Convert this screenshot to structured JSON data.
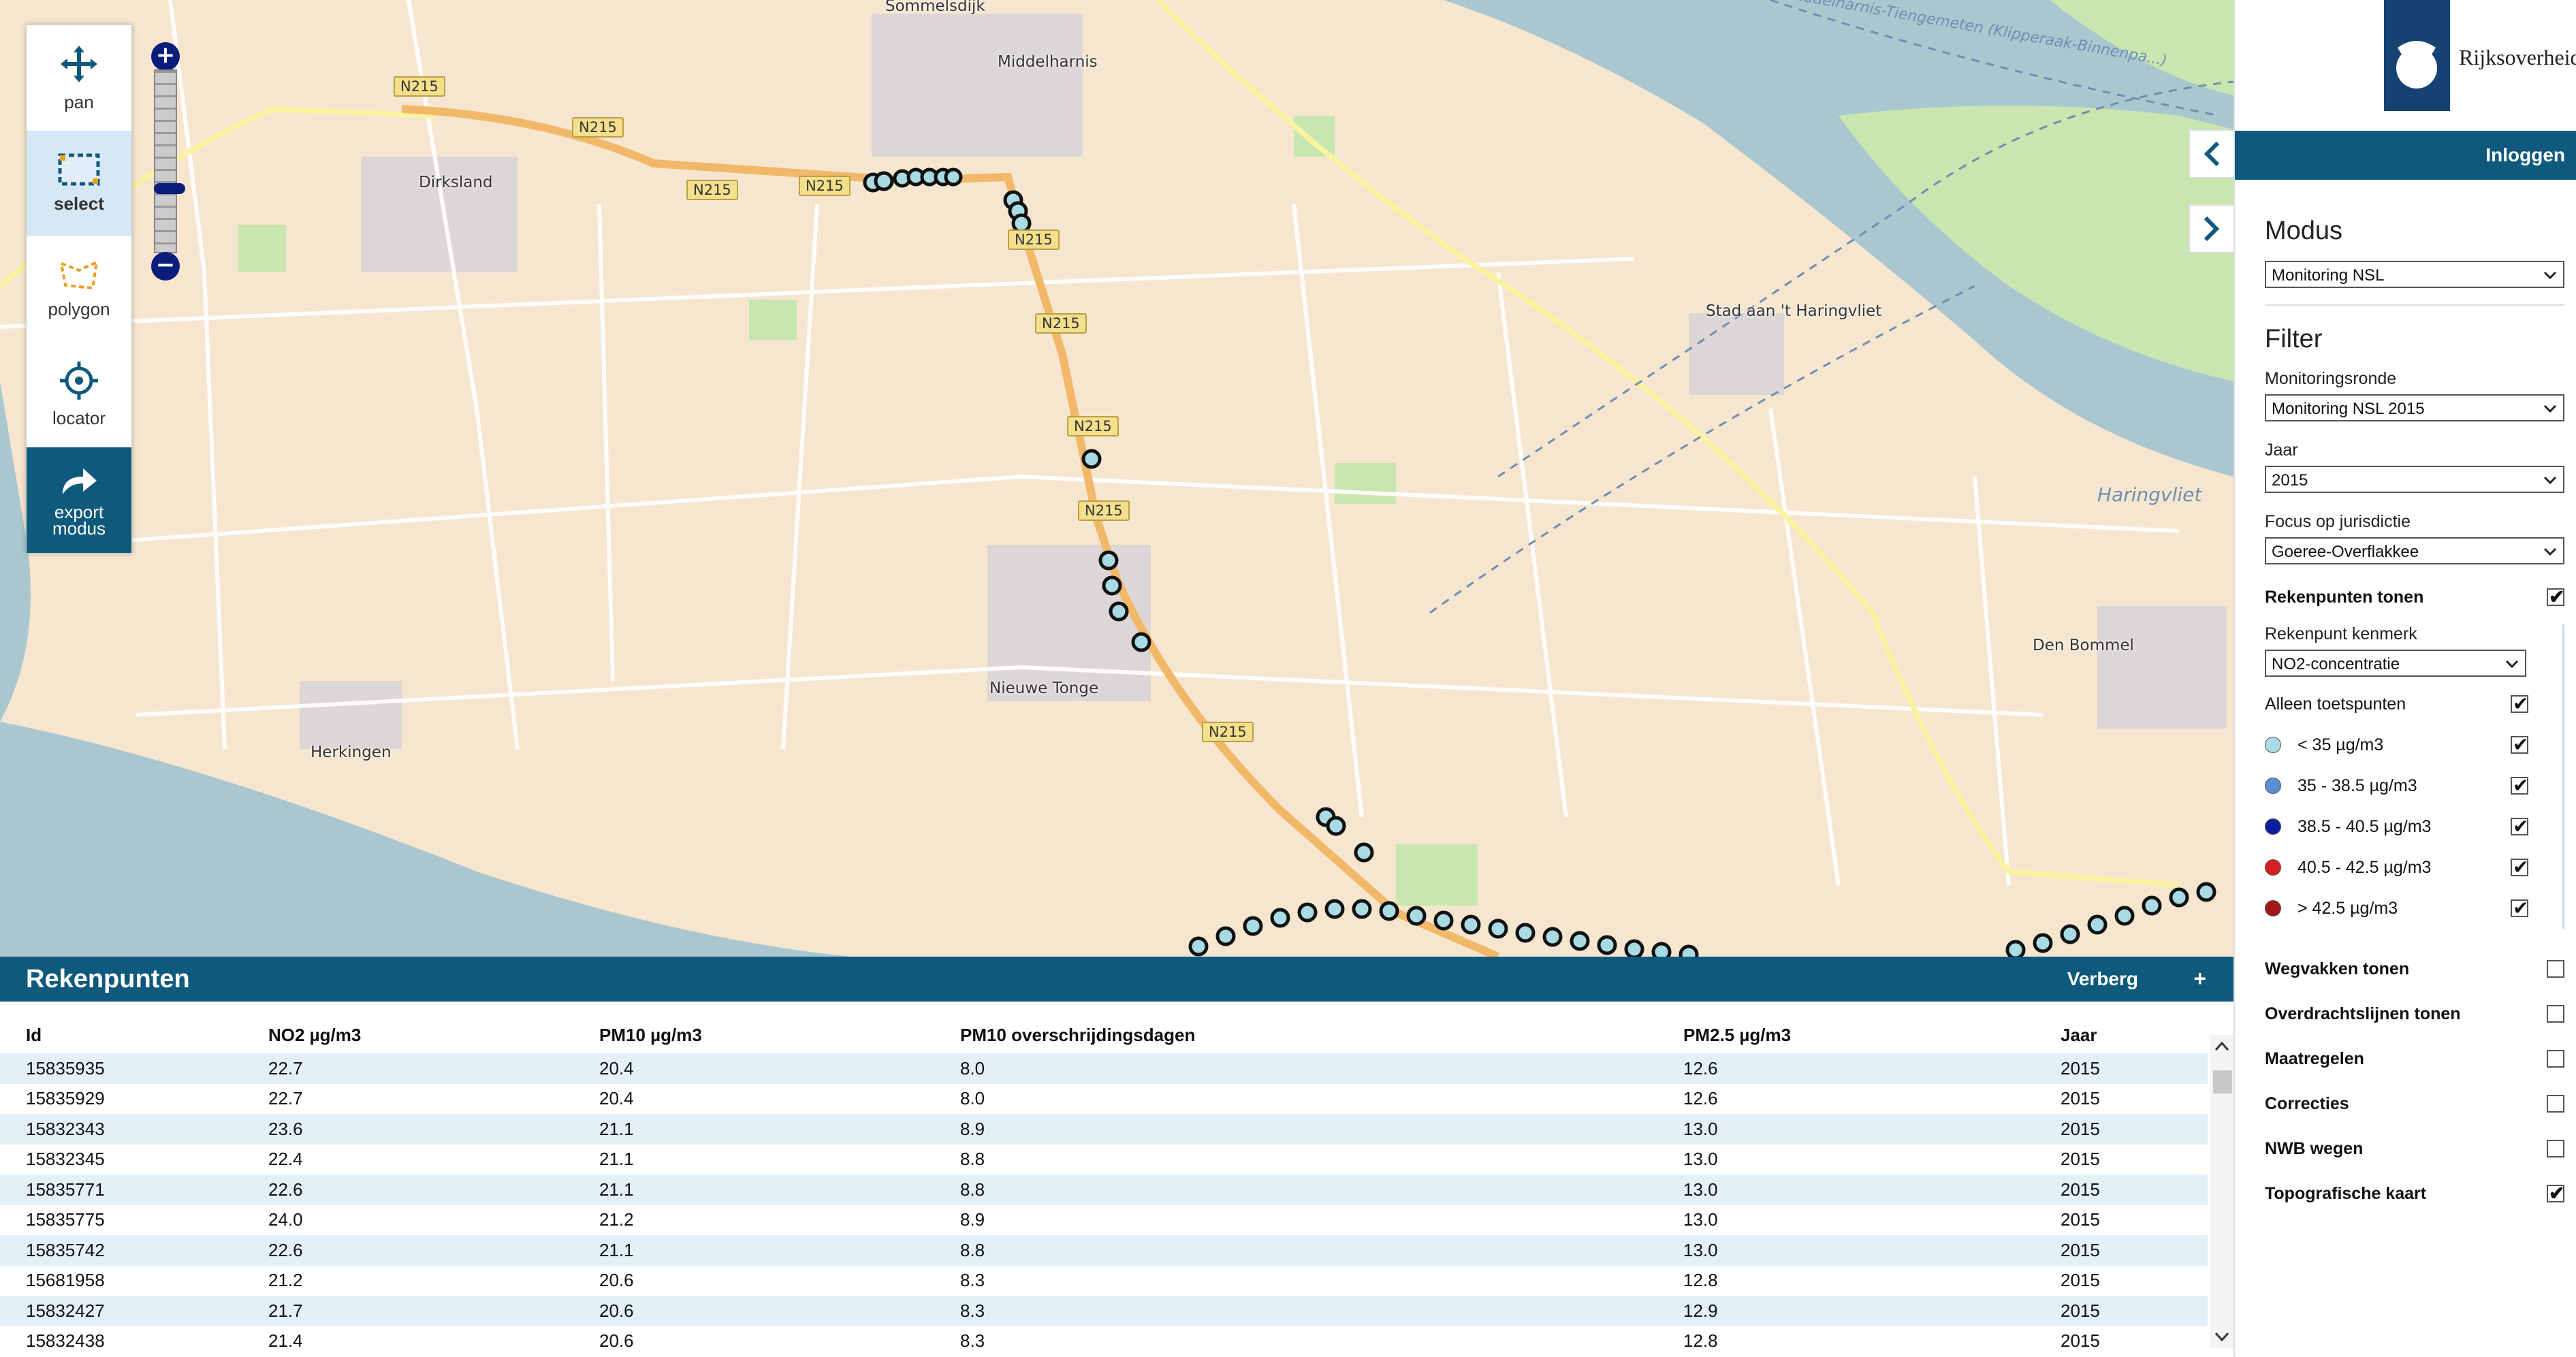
{
  "toolbar": {
    "tools": [
      {
        "label": "pan",
        "icon": "pan-icon"
      },
      {
        "label": "select",
        "icon": "select-icon"
      },
      {
        "label": "polygon",
        "icon": "polygon-icon"
      },
      {
        "label": "locator",
        "icon": "locator-icon"
      },
      {
        "label": "export modus",
        "icon": "export-icon"
      }
    ]
  },
  "zoom": {
    "plus": "+",
    "minus": "−"
  },
  "map": {
    "places": [
      "Middelharnis",
      "Dirksland",
      "Stad aan 't Haringvliet",
      "Nieuwe Tonge",
      "Herkingen",
      "Den Bommel",
      "Sommelsdijk"
    ],
    "water_labels": [
      "Haringvliet",
      "Middelharnis-Tiengemeten (Klipperaak-Binnenpa...)"
    ],
    "roads": [
      "N215",
      "N215",
      "N215",
      "N215",
      "N215",
      "N215",
      "N215",
      "N215",
      "N215"
    ],
    "colors": {
      "land": "#f7e6cf",
      "water": "#aac7d0",
      "road_major": "#f2b86a",
      "road_minor": "#ffffff",
      "green": "#c9e6b1"
    }
  },
  "panel": {
    "logo_text": "Rijksoverheid",
    "login": "Inloggen",
    "modus_title": "Modus",
    "modus_value": "Monitoring NSL",
    "filter_title": "Filter",
    "monitoringsronde_label": "Monitoringsronde",
    "monitoringsronde_value": "Monitoring NSL 2015",
    "jaar_label": "Jaar",
    "jaar_value": "2015",
    "focus_label": "Focus op jurisdictie",
    "focus_value": "Goeree-Overflakkee",
    "rekenpunten_tonen": "Rekenpunten tonen",
    "kenmerk_label": "Rekenpunt kenmerk",
    "kenmerk_value": "NO2-concentratie",
    "alleen_toetspunten": "Alleen toetspunten",
    "legend": [
      {
        "label": "< 35 µg/m3",
        "color": "#a9dbe4"
      },
      {
        "label": "35 - 38.5 µg/m3",
        "color": "#5a8fd6"
      },
      {
        "label": "38.5 - 40.5 µg/m3",
        "color": "#0b1f9e"
      },
      {
        "label": "40.5 - 42.5 µg/m3",
        "color": "#d92020"
      },
      {
        "label": "> 42.5 µg/m3",
        "color": "#a31818"
      }
    ],
    "layers": [
      {
        "label": "Wegvakken tonen",
        "checked": false
      },
      {
        "label": "Overdrachtslijnen tonen",
        "checked": false
      },
      {
        "label": "Maatregelen",
        "checked": false
      },
      {
        "label": "Correcties",
        "checked": false
      },
      {
        "label": "NWB wegen",
        "checked": false
      },
      {
        "label": "Topografische kaart",
        "checked": true
      }
    ]
  },
  "table": {
    "title": "Rekenpunten",
    "hide": "Verberg",
    "plus": "+",
    "columns": [
      "Id",
      "NO2 µg/m3",
      "PM10 µg/m3",
      "PM10 overschrijdingsdagen",
      "PM2.5 µg/m3",
      "Jaar"
    ],
    "rows": [
      [
        "15835935",
        "22.7",
        "20.4",
        "8.0",
        "12.6",
        "2015"
      ],
      [
        "15835929",
        "22.7",
        "20.4",
        "8.0",
        "12.6",
        "2015"
      ],
      [
        "15832343",
        "23.6",
        "21.1",
        "8.9",
        "13.0",
        "2015"
      ],
      [
        "15832345",
        "22.4",
        "21.1",
        "8.8",
        "13.0",
        "2015"
      ],
      [
        "15835771",
        "22.6",
        "21.1",
        "8.8",
        "13.0",
        "2015"
      ],
      [
        "15835775",
        "24.0",
        "21.2",
        "8.9",
        "13.0",
        "2015"
      ],
      [
        "15835742",
        "22.6",
        "21.1",
        "8.8",
        "13.0",
        "2015"
      ],
      [
        "15681958",
        "21.2",
        "20.6",
        "8.3",
        "12.8",
        "2015"
      ],
      [
        "15832427",
        "21.7",
        "20.6",
        "8.3",
        "12.9",
        "2015"
      ],
      [
        "15832438",
        "21.4",
        "20.6",
        "8.3",
        "12.8",
        "2015"
      ]
    ]
  }
}
